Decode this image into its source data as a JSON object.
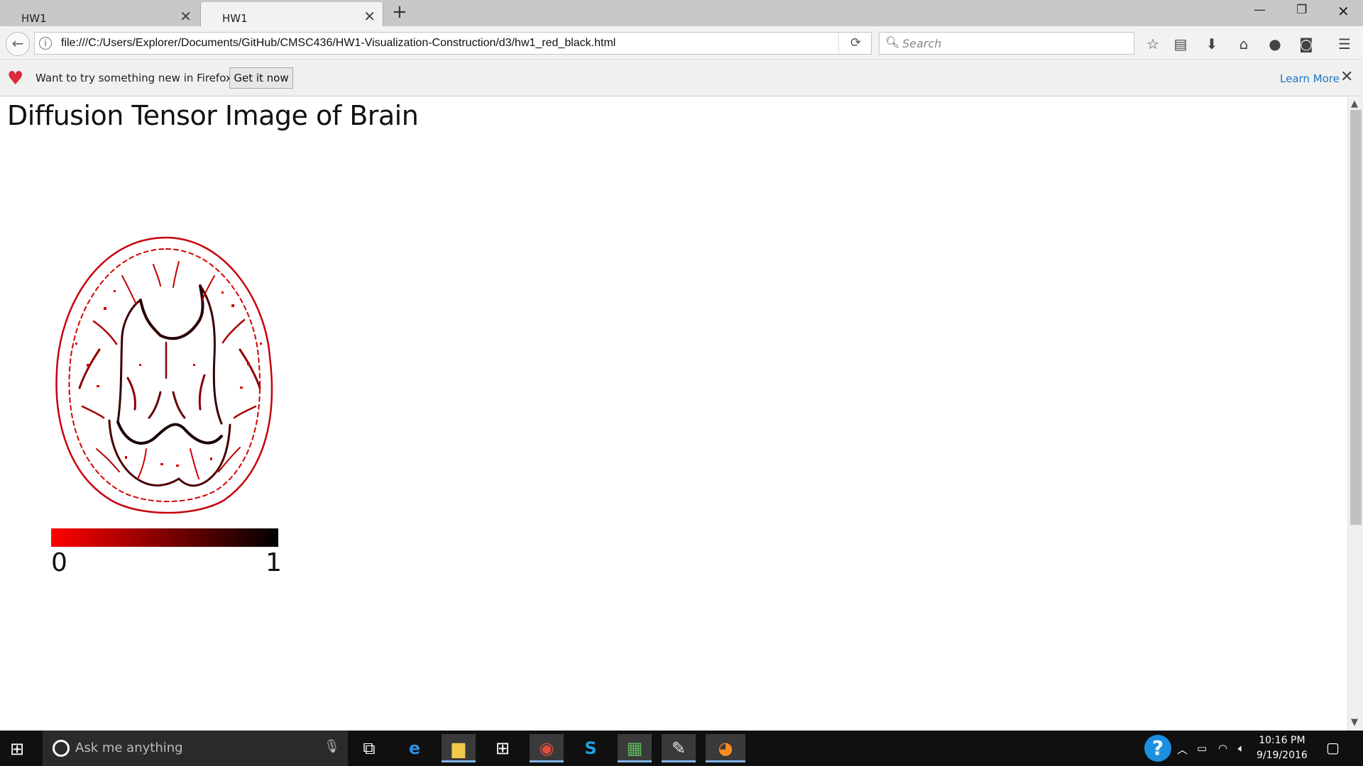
{
  "browser": {
    "tabs": [
      {
        "label": "HW1"
      },
      {
        "label": "HW1"
      }
    ],
    "url": "file:///C:/Users/Explorer/Documents/GitHub/CMSC436/HW1-Visualization-Construction/d3/hw1_red_black.html",
    "search_placeholder": "Search"
  },
  "notification": {
    "message": "Want to try something new in Firefox?",
    "button": "Get it now",
    "link": "Learn More"
  },
  "page": {
    "title": "Diffusion Tensor Image of Brain",
    "legend": {
      "min_label": "0",
      "max_label": "1",
      "color_low": "#ff0000",
      "color_high": "#000000"
    }
  },
  "taskbar": {
    "search_placeholder": "Ask me anything",
    "time": "10:16 PM",
    "date": "9/19/2016",
    "apps": [
      "task-view",
      "edge",
      "file-explorer",
      "store",
      "chrome",
      "skype",
      "excel-like",
      "paint",
      "firefox"
    ]
  },
  "colors": {
    "accent_link": "#1b74c8",
    "heart": "#d92b3a",
    "taskbar": "#101010"
  }
}
